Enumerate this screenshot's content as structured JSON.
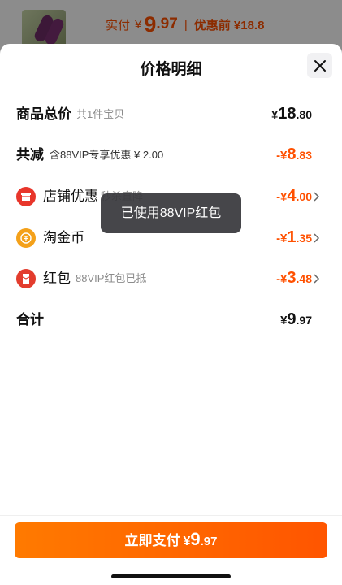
{
  "background": {
    "actual_label": "实付",
    "actual_currency": "¥",
    "actual_int": "9",
    "actual_dec": ".97",
    "separator": "|",
    "before_label": "优惠前 ¥18.8"
  },
  "sheet": {
    "title": "价格明细",
    "close_icon": "close-icon"
  },
  "rows": {
    "total": {
      "label": "商品总价",
      "sub": "共1件宝贝",
      "currency": "¥",
      "int": "18",
      "dec": ".80"
    },
    "reduce": {
      "label": "共减",
      "sub": "含88VIP专享优惠 ¥ 2.00",
      "prefix": "-¥",
      "int": "8",
      "dec": ".83"
    },
    "shop": {
      "label": "店铺优惠",
      "sub": "秒杀直降",
      "prefix": "-¥",
      "int": "4",
      "dec": ".00",
      "icon": "shop-coupon-icon",
      "icon_color": "#e8362b"
    },
    "coin": {
      "label": "淘金币",
      "prefix": "-¥",
      "int": "1",
      "dec": ".35",
      "icon": "taojinbi-coin-icon",
      "icon_color": "#f4a11a"
    },
    "redpacket": {
      "label": "红包",
      "sub": "88VIP红包已抵",
      "prefix": "-¥",
      "int": "3",
      "dec": ".48",
      "icon": "red-packet-icon",
      "icon_color": "#e33c2d"
    },
    "sum": {
      "label": "合计",
      "currency": "¥",
      "int": "9",
      "dec": ".97"
    }
  },
  "toast": {
    "text": "已使用88VIP红包"
  },
  "pay": {
    "label": "立即支付",
    "currency": "¥",
    "int": "9",
    "dec": ".97"
  },
  "colors": {
    "accent": "#ff5000",
    "button": "#ff6a00"
  }
}
